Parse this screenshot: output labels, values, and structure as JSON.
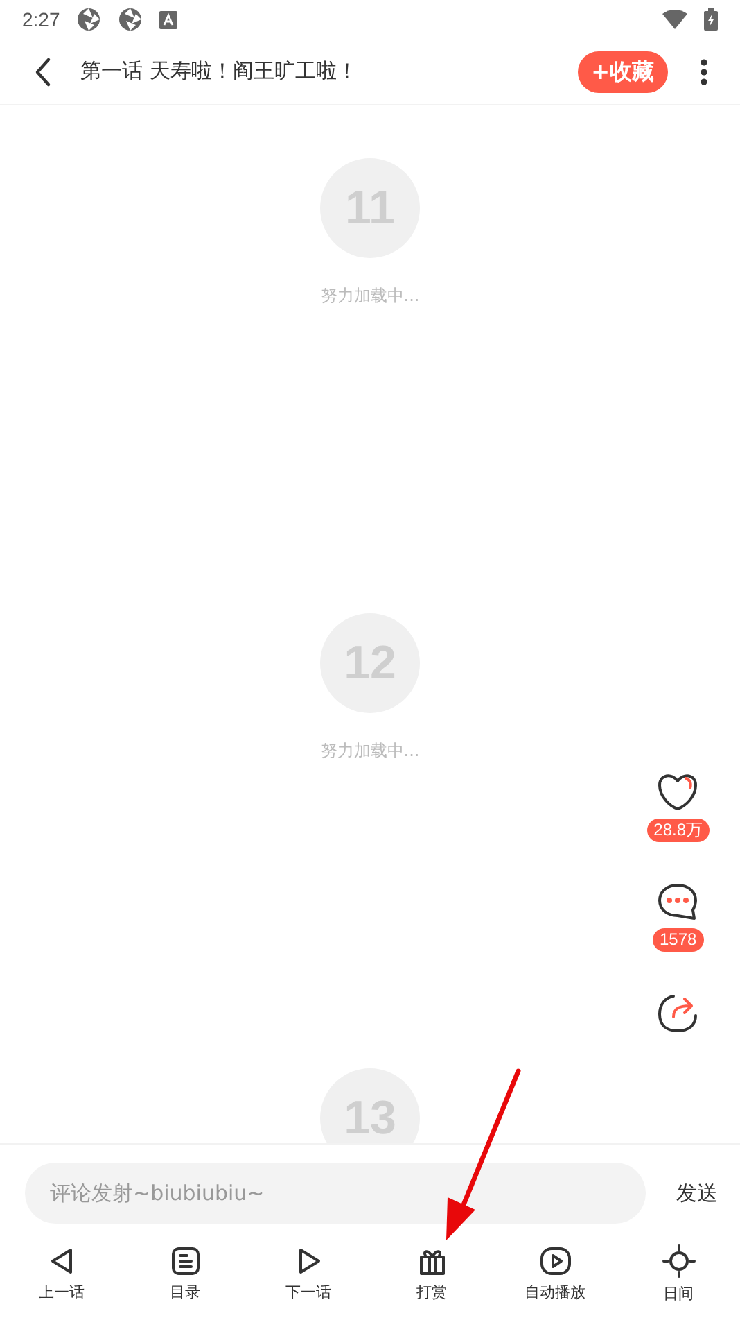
{
  "status_bar": {
    "time": "2:27"
  },
  "header": {
    "title": "第一话 天寿啦！阎王旷工啦！",
    "favorite_button": "+收藏"
  },
  "pages": [
    {
      "number": "11",
      "loading_text": "努力加载中..."
    },
    {
      "number": "12",
      "loading_text": "努力加载中..."
    },
    {
      "number": "13"
    }
  ],
  "side_actions": [
    {
      "kind": "like",
      "count": "28.8万"
    },
    {
      "kind": "comment",
      "count": "1578"
    },
    {
      "kind": "share"
    }
  ],
  "comment_bar": {
    "placeholder": "评论发射~biubiubiu~",
    "send_button": "发送"
  },
  "bottom_nav": [
    {
      "kind": "prev",
      "label": "上一话"
    },
    {
      "kind": "catalog",
      "label": "目录"
    },
    {
      "kind": "next",
      "label": "下一话"
    },
    {
      "kind": "gift",
      "label": "打赏"
    },
    {
      "kind": "autoplay",
      "label": "自动播放"
    },
    {
      "kind": "brightness",
      "label": "日间"
    }
  ]
}
